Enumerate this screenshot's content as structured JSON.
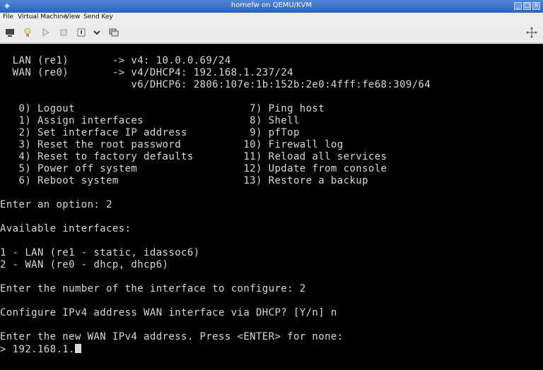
{
  "window": {
    "title": "homefw on QEMU/KVM",
    "min_glyph": "_",
    "max_glyph": "□",
    "close_glyph": "×"
  },
  "menu": [
    "File",
    "Virtual Machine",
    "View",
    "Send Key"
  ],
  "toolbar_icons": [
    "console-icon",
    "lightbulb-icon",
    "run-icon",
    "pause-icon",
    "shutdown-icon",
    "dropdown-chevron-icon",
    "snapshot-icon",
    "fullscreen-icon"
  ],
  "console": {
    "lines": [
      "  LAN (re1)       -> v4: 10.0.0.69/24",
      "  WAN (re0)       -> v4/DHCP4: 192.168.1.237/24",
      "                     v6/DHCP6: 2806:107e:1b:152b:2e0:4fff:fe68:309/64",
      "",
      "   0) Logout                            7) Ping host",
      "   1) Assign interfaces                 8) Shell",
      "   2) Set interface IP address          9) pfTop",
      "   3) Reset the root password          10) Firewall log",
      "   4) Reset to factory defaults        11) Reload all services",
      "   5) Power off system                 12) Update from console",
      "   6) Reboot system                    13) Restore a backup",
      "",
      "Enter an option: 2",
      "",
      "Available interfaces:",
      "",
      "1 - LAN (re1 - static, idassoc6)",
      "2 - WAN (re0 - dhcp, dhcp6)",
      "",
      "Enter the number of the interface to configure: 2",
      "",
      "Configure IPv4 address WAN interface via DHCP? [Y/n] n",
      "",
      "Enter the new WAN IPv4 address. Press <ENTER> for none:"
    ],
    "prompt_line": "> 192.168.1."
  }
}
